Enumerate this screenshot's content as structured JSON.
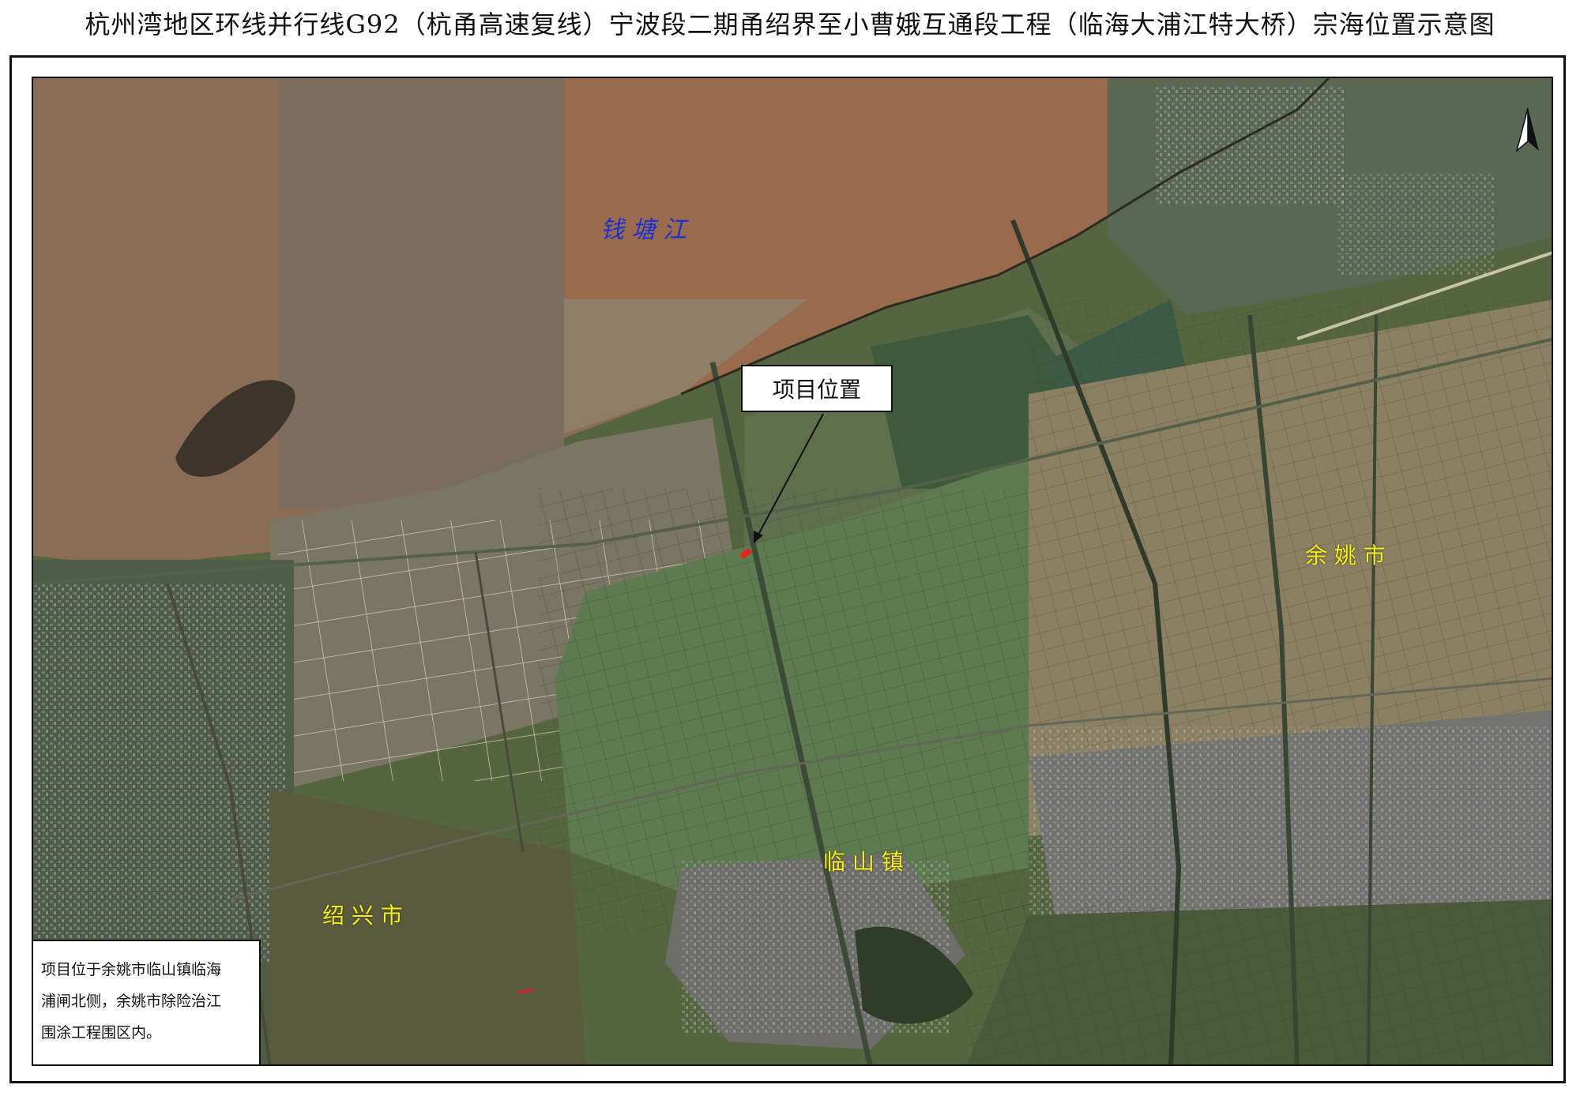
{
  "map": {
    "title": "杭州湾地区环线并行线G92（杭甬高速复线）宁波段二期甬绍界至小曹娥互通段工程（临海大浦江特大桥）宗海位置示意图",
    "water_label": "钱 塘 江",
    "callout_label": "项目位置",
    "places": {
      "yuyao": "余 姚 市",
      "linshan": "临 山 镇",
      "shaoxing": "绍 兴 市"
    },
    "note_lines": [
      "项目位于余姚市临山镇临海",
      "浦闸北侧，余姚市除险治江",
      "围涂工程围区内。"
    ],
    "compass_icon": "north-arrow-icon",
    "colors": {
      "place_label": "#f4ee22",
      "water_label": "#1a2fd6",
      "project_marker": "#e8231c"
    }
  }
}
